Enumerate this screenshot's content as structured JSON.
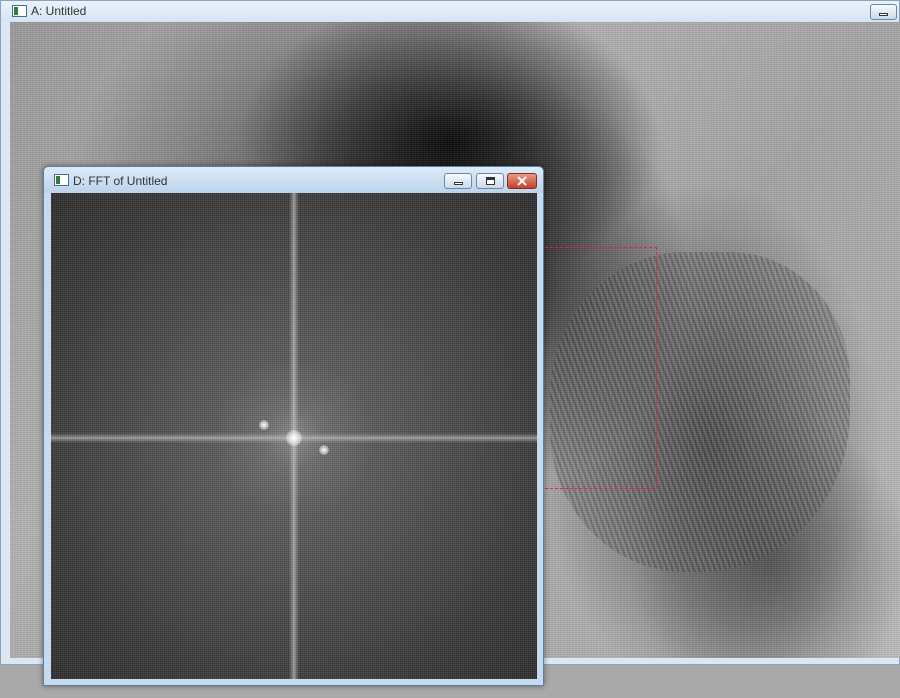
{
  "window_a": {
    "title": "A: Untitled",
    "title_icon": "image-window-icon",
    "buttons": [
      {
        "name": "minimize-icon"
      }
    ],
    "selection": {
      "shape": "rectangle",
      "color": "#e0283c",
      "style": "dashed"
    }
  },
  "window_d": {
    "title": "D: FFT of Untitled",
    "title_icon": "image-window-icon",
    "buttons": [
      {
        "name": "minimize-icon"
      },
      {
        "name": "maximize-icon"
      },
      {
        "name": "close-icon"
      }
    ]
  },
  "colors": {
    "titlebar": "#dbe7f3",
    "close_button": "#c4412b",
    "selection_outline": "#e0283c"
  }
}
